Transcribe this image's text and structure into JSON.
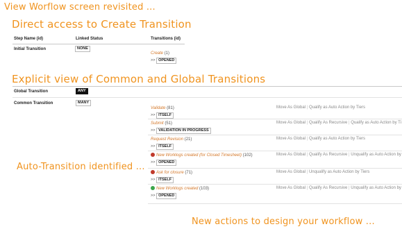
{
  "headings": {
    "main": "View Worflow screen revisited ...",
    "direct": "Direct access to Create Transition",
    "explicit": "Explicit view of Common and Global Transitions",
    "auto": "Auto-Transition identified ...",
    "new_actions": "New actions to design your workflow ..."
  },
  "initial_table": {
    "col_step": "Step Name (id)",
    "col_linked": "Linked Status",
    "col_trans": "Transitions (id)",
    "row_label": "Initial Transition",
    "row_status": "NONE",
    "transition": {
      "name": "Create",
      "id": "(1)",
      "arrow": ">>",
      "target": "OPENED"
    }
  },
  "global_row": {
    "label": "Global Transition",
    "badge": "ANY"
  },
  "common_row": {
    "label": "Common Transition",
    "badge": "MANY"
  },
  "transitions": [
    {
      "icon": "",
      "name": "Validate",
      "id": "(81)",
      "arrow": ">>",
      "target": "ITSELF",
      "actions": [
        "Move As Global",
        "Qualify as Auto Action by Tiers"
      ]
    },
    {
      "icon": "",
      "name": "Submit",
      "id": "(51)",
      "arrow": ">>",
      "target": "VALIDATION IN PROGRESS",
      "actions": [
        "Move As Global",
        "Qualify As Recursive",
        "Qualify as Auto Action by Ti"
      ]
    },
    {
      "icon": "",
      "name": "Request Revision",
      "id": "(21)",
      "arrow": ">>",
      "target": "ITSELF",
      "actions": [
        "Move As Global",
        "Qualify as Auto Action by Tiers"
      ]
    },
    {
      "icon": "warning-icon",
      "name": "New Worklogs created (for Closed Timesheet)",
      "id": "(102)",
      "arrow": ">>",
      "target": "OPENED",
      "actions": [
        "Move As Global",
        "Qualify As Recursive",
        "Unqualify as Auto Action by"
      ]
    },
    {
      "icon": "warning-icon",
      "name": "Ask for closure",
      "id": "(71)",
      "arrow": ">>",
      "target": "ITSELF",
      "actions": [
        "Move As Global",
        "Unqualify as Auto Action by Tiers"
      ]
    },
    {
      "icon": "auto-icon",
      "name": "New Worklogs created",
      "id": "(103)",
      "arrow": ">>",
      "target": "OPENED",
      "actions": [
        "Move As Global",
        "Qualify As Recursive",
        "Unqualify as Auto Action by"
      ]
    }
  ]
}
